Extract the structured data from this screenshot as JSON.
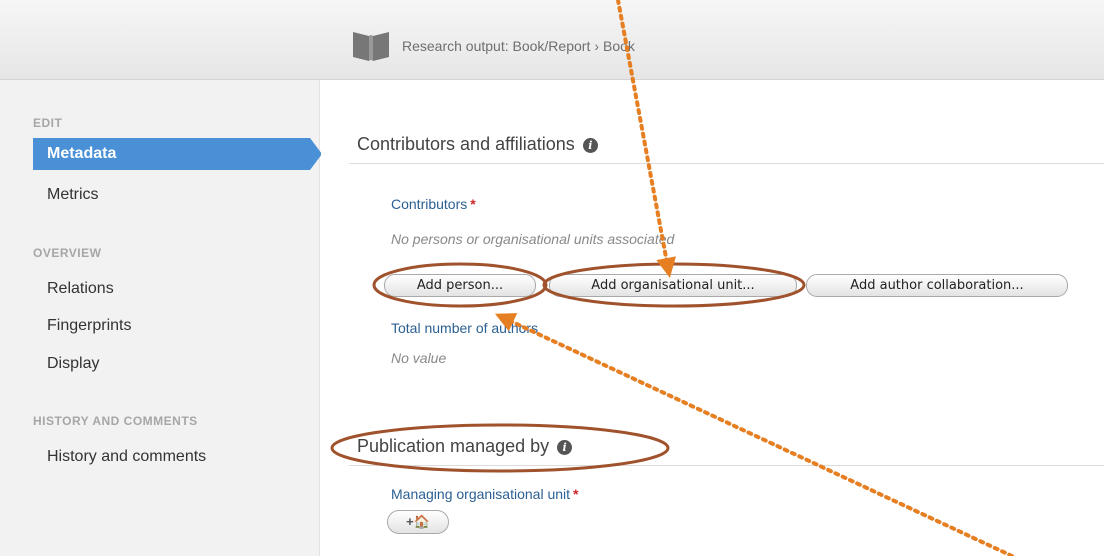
{
  "header": {
    "breadcrumb_part1": "Research output: Book/Report",
    "breadcrumb_separator": "›",
    "breadcrumb_part2": "Book"
  },
  "sidebar": {
    "edit_title": "EDIT",
    "metadata": "Metadata",
    "metrics": "Metrics",
    "overview_title": "OVERVIEW",
    "relations": "Relations",
    "fingerprints": "Fingerprints",
    "display": "Display",
    "history_title": "HISTORY AND COMMENTS",
    "history": "History and comments"
  },
  "main": {
    "contributors_section": {
      "title": "Contributors and affiliations",
      "contributors_label": "Contributors",
      "required_mark": "*",
      "empty_text": "No persons or organisational units associated",
      "add_person": "Add person...",
      "add_org_unit": "Add organisational unit...",
      "add_author_collab": "Add author collaboration...",
      "total_authors_label": "Total number of authors",
      "total_authors_value": "No value"
    },
    "managed_section": {
      "title": "Publication managed by",
      "managing_label": "Managing organisational unit",
      "required_mark": "*",
      "add_icon_label": "+🏠"
    }
  },
  "colors": {
    "accent_blue": "#4a90d6",
    "label_blue": "#2b5f93",
    "annotation_brown": "#a0522d",
    "annotation_orange": "#e67e22",
    "required_red": "#d0262a"
  },
  "icons": [
    "book-icon",
    "info-icon",
    "add-home-icon"
  ]
}
